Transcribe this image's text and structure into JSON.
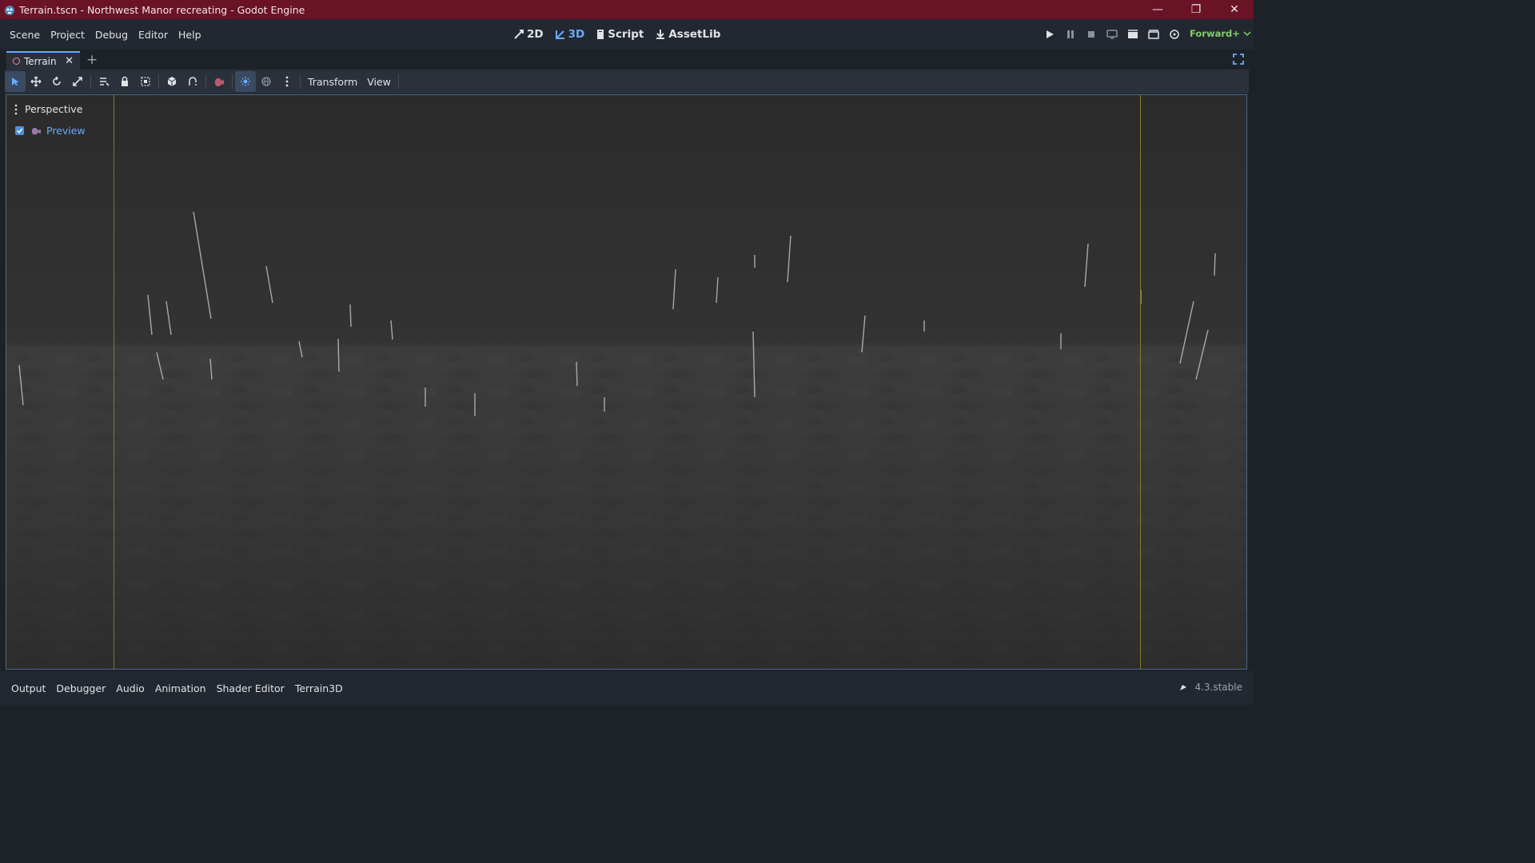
{
  "window": {
    "title": "Terrain.tscn - Northwest Manor recreating - Godot Engine",
    "controls": [
      "minimize-icon",
      "restore-icon",
      "close-icon"
    ]
  },
  "menu": {
    "items": [
      "Scene",
      "Project",
      "Debug",
      "Editor",
      "Help"
    ]
  },
  "workspaces": [
    {
      "label": "2D",
      "icon": "2d-icon",
      "active": false
    },
    {
      "label": "3D",
      "icon": "3d-icon",
      "active": true
    },
    {
      "label": "Script",
      "icon": "script-icon",
      "active": false
    },
    {
      "label": "AssetLib",
      "icon": "assetlib-icon",
      "active": false
    }
  ],
  "renderer": "Forward+",
  "tabs": {
    "scene_tab": "Terrain"
  },
  "toolbar": {
    "transform_label": "Transform",
    "view_label": "View"
  },
  "viewport": {
    "perspective_label": "Perspective",
    "preview_label": "Preview",
    "preview_checked": true
  },
  "bottom_tabs": [
    "Output",
    "Debugger",
    "Audio",
    "Animation",
    "Shader Editor",
    "Terrain3D"
  ],
  "version": "4.3.stable",
  "colors": {
    "titlebar": "#6a1226",
    "accent": "#6aa9ff",
    "renderer": "#7fcf6a",
    "guide_lines": "#8a7a1e"
  }
}
